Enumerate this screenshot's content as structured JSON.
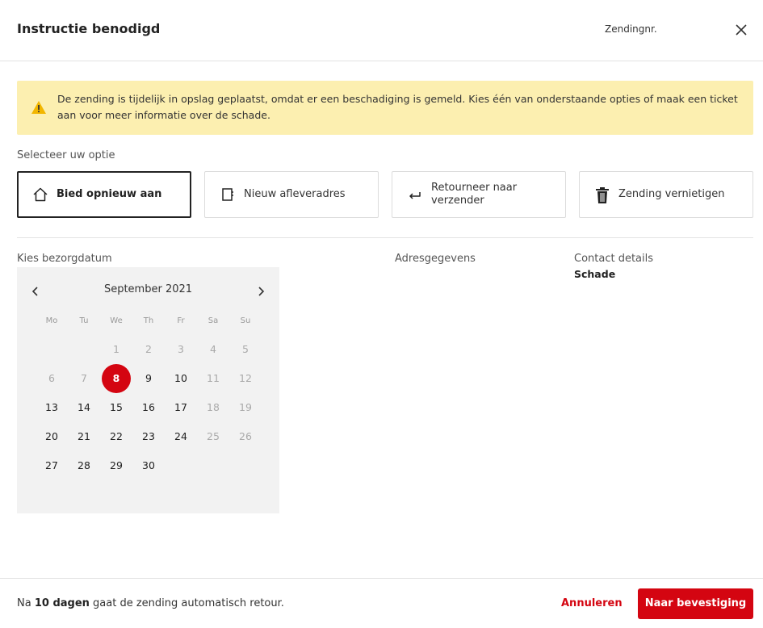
{
  "header": {
    "title": "Instructie benodigd",
    "shipment_label": "Zendingnr.",
    "close_icon": "close-icon"
  },
  "alert": {
    "icon": "warning-icon",
    "text": "De zending is tijdelijk in opslag geplaatst, omdat er een beschadiging is gemeld. Kies één van onderstaande opties of maak een ticket aan voor meer informatie over de schade."
  },
  "options": {
    "label": "Selecteer uw optie",
    "items": [
      {
        "label": "Bied opnieuw aan",
        "icon": "home-icon",
        "selected": true
      },
      {
        "label": "Nieuw afleveradres",
        "icon": "address-book-icon",
        "selected": false
      },
      {
        "label": "Retourneer naar verzender",
        "icon": "return-arrow-icon",
        "selected": false
      },
      {
        "label": "Zending vernietigen",
        "icon": "trash-icon",
        "selected": false
      }
    ]
  },
  "delivery": {
    "label": "Kies bezorgdatum",
    "calendar": {
      "month": "September 2021",
      "weekdays": [
        "Mo",
        "Tu",
        "We",
        "Th",
        "Fr",
        "Sa",
        "Su"
      ],
      "weeks": [
        [
          null,
          null,
          "1",
          "2",
          "3",
          "4",
          "5"
        ],
        [
          "6",
          "7",
          "8",
          "9",
          "10",
          "11",
          "12"
        ],
        [
          "13",
          "14",
          "15",
          "16",
          "17",
          "18",
          "19"
        ],
        [
          "20",
          "21",
          "22",
          "23",
          "24",
          "25",
          "26"
        ],
        [
          "27",
          "28",
          "29",
          "30",
          null,
          null,
          null
        ]
      ],
      "disabled": [
        "1",
        "2",
        "3",
        "4",
        "5",
        "6",
        "7",
        "11",
        "12",
        "18",
        "19",
        "25",
        "26"
      ],
      "selected": "8"
    }
  },
  "address": {
    "label": "Adresgegevens"
  },
  "contact": {
    "label": "Contact details",
    "value": "Schade"
  },
  "footer": {
    "prefix": "Na ",
    "days": "10 dagen",
    "suffix": " gaat de zending automatisch retour.",
    "cancel_label": "Annuleren",
    "confirm_label": "Naar bevestiging"
  },
  "colors": {
    "accent": "#d40511",
    "alert_bg": "#fcefb0",
    "calendar_bg": "#f2f2f2"
  }
}
